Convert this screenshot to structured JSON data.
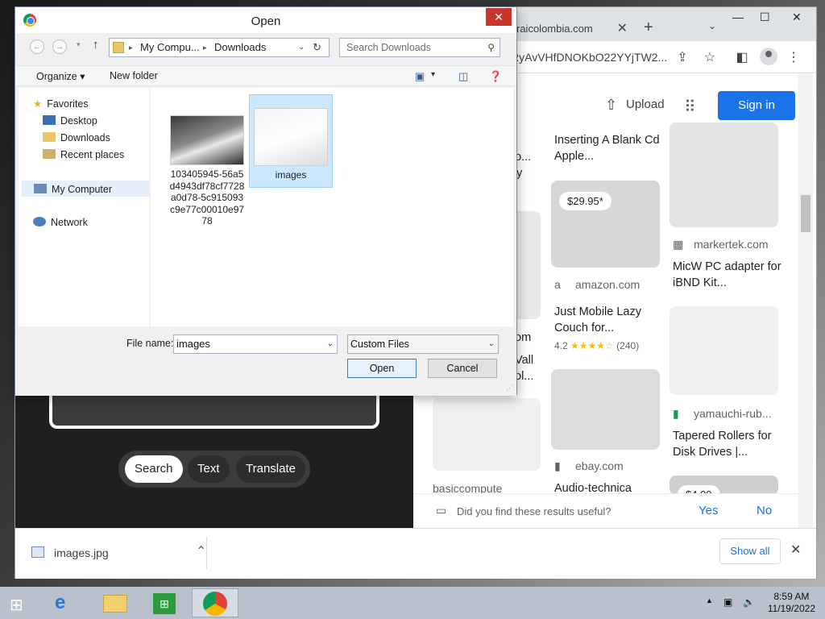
{
  "browser": {
    "tab_title": "raicolombia.com",
    "url_text": "RyAvVHfDNOKbO22YYjTW2...",
    "win_min": "—",
    "win_max": "☐",
    "win_close": "✕"
  },
  "page": {
    "upload_label": "Upload",
    "signin_label": "Sign in",
    "lens_buttons": [
      "Search",
      "Text",
      "Translate"
    ],
    "results": [
      {
        "title": "Inserting A Blank Cd Apple..."
      },
      {
        "price": "$29.95*",
        "source": "amazon.com",
        "title": "Just Mobile Lazy Couch for...",
        "rating": "4.2",
        "reviews": "(240)"
      },
      {
        "source": "ebay.com",
        "title": "Audio-technica"
      },
      {
        "source": "markertek.com",
        "title": "MicW PC adapter for iBND Kit..."
      },
      {
        "source": "yamauchi-rub...",
        "title": "Tapered Rollers for Disk Drives |..."
      },
      {
        "source": "basiccompute"
      },
      {
        "price": "$4.00"
      }
    ],
    "left_fragments": [
      "eo...",
      "y",
      "om",
      "Vall",
      "ol..."
    ],
    "feedback_question": "Did you find these results useful?",
    "feedback_yes": "Yes",
    "feedback_no": "No"
  },
  "downloads": {
    "item_name": "images.jpg",
    "show_all": "Show all"
  },
  "dialog": {
    "title": "Open",
    "address_parts": [
      "My Compu...",
      "Downloads"
    ],
    "search_placeholder": "Search Downloads",
    "organize": "Organize",
    "new_folder": "New folder",
    "nav": {
      "favorites": "Favorites",
      "desktop": "Desktop",
      "downloads": "Downloads",
      "recent": "Recent places",
      "my_computer": "My Computer",
      "network": "Network"
    },
    "files": [
      {
        "name": "103405945-56a5d4943df78cf7728a0d78-5c915093c9e77c00010e9778"
      },
      {
        "name": "images"
      }
    ],
    "file_name_label": "File name:",
    "file_name_value": "images",
    "file_type": "Custom Files",
    "open_label": "Open",
    "cancel_label": "Cancel"
  },
  "taskbar": {
    "time": "8:59 AM",
    "date": "11/19/2022"
  }
}
